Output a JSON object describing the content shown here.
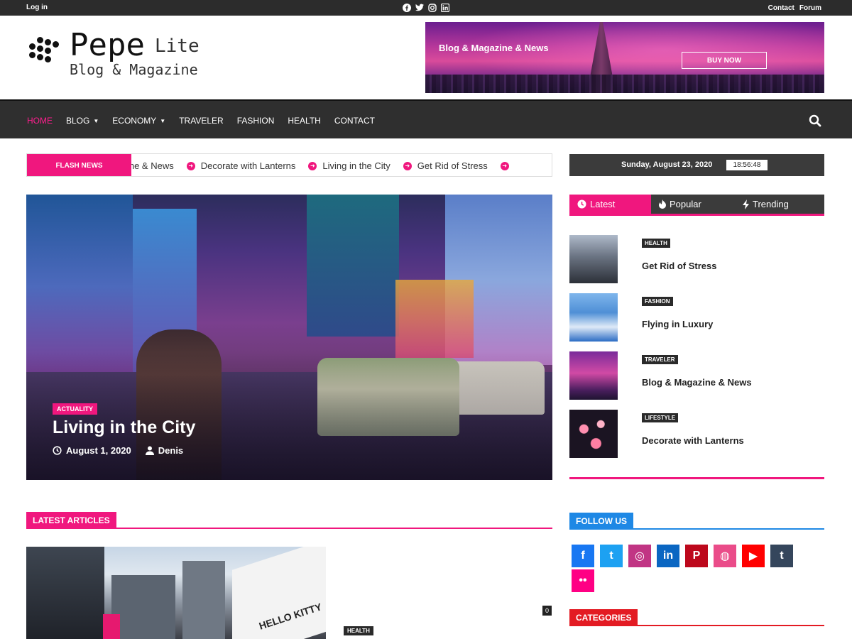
{
  "topbar": {
    "login": "Log in",
    "links": [
      "Contact",
      "Forum"
    ],
    "social_icons": [
      "facebook-icon",
      "twitter-icon",
      "instagram-icon",
      "linkedin-icon"
    ]
  },
  "header": {
    "logo_title": "Pepe",
    "logo_lite": "Lite",
    "logo_subtitle": "Blog & Magazine",
    "banner": {
      "text": "Blog & Magazine & News",
      "button": "BUY NOW"
    }
  },
  "nav": {
    "items": [
      {
        "label": "HOME",
        "active": true,
        "dropdown": false
      },
      {
        "label": "BLOG",
        "active": false,
        "dropdown": true
      },
      {
        "label": "ECONOMY",
        "active": false,
        "dropdown": true
      },
      {
        "label": "TRAVELER",
        "active": false,
        "dropdown": false
      },
      {
        "label": "FASHION",
        "active": false,
        "dropdown": false
      },
      {
        "label": "HEALTH",
        "active": false,
        "dropdown": false
      },
      {
        "label": "CONTACT",
        "active": false,
        "dropdown": false
      }
    ],
    "search_icon": "search-icon"
  },
  "flash": {
    "label": "FLASH NEWS",
    "items": [
      "gazine & News",
      "Decorate with Lanterns",
      "Living in the City",
      "Get Rid of Stress"
    ]
  },
  "datebar": {
    "date": "Sunday, August 23, 2020",
    "time": "18:56:48"
  },
  "hero": {
    "category": "ACTUALITY",
    "title": "Living in the City",
    "date": "August 1, 2020",
    "author": "Denis"
  },
  "sidebar": {
    "tabs": [
      "Latest",
      "Popular",
      "Trending"
    ],
    "posts": [
      {
        "tag": "HEALTH",
        "title": "Get Rid of Stress"
      },
      {
        "tag": "FASHION",
        "title": "Flying in Luxury"
      },
      {
        "tag": "TRAVELER",
        "title": "Blog & Magazine & News"
      },
      {
        "tag": "LIFESTYLE",
        "title": "Decorate with Lanterns"
      }
    ],
    "follow_us": "FOLLOW US",
    "categories": "CATEGORIES",
    "social": [
      {
        "name": "facebook-icon",
        "glyph": "f",
        "color": "#1877f2"
      },
      {
        "name": "twitter-icon",
        "glyph": "t",
        "color": "#1da1f2"
      },
      {
        "name": "instagram-icon",
        "glyph": "◎",
        "color": "#c13584"
      },
      {
        "name": "linkedin-icon",
        "glyph": "in",
        "color": "#0a66c2"
      },
      {
        "name": "pinterest-icon",
        "glyph": "P",
        "color": "#bd081c"
      },
      {
        "name": "dribbble-icon",
        "glyph": "◍",
        "color": "#ea4c89"
      },
      {
        "name": "youtube-icon",
        "glyph": "▶",
        "color": "#ff0000"
      },
      {
        "name": "tumblr-icon",
        "glyph": "t",
        "color": "#35465c"
      },
      {
        "name": "flickr-icon",
        "glyph": "••",
        "color": "#ff0084"
      }
    ]
  },
  "latest": {
    "label": "LATEST ARTICLES",
    "comment_count": "0",
    "tag": "HEALTH",
    "image_text": "HELLO KITTY"
  },
  "colors": {
    "accent": "#f0177e",
    "dark": "#2f2f2f",
    "follow": "#1e88e5",
    "categories": "#e31b23"
  }
}
